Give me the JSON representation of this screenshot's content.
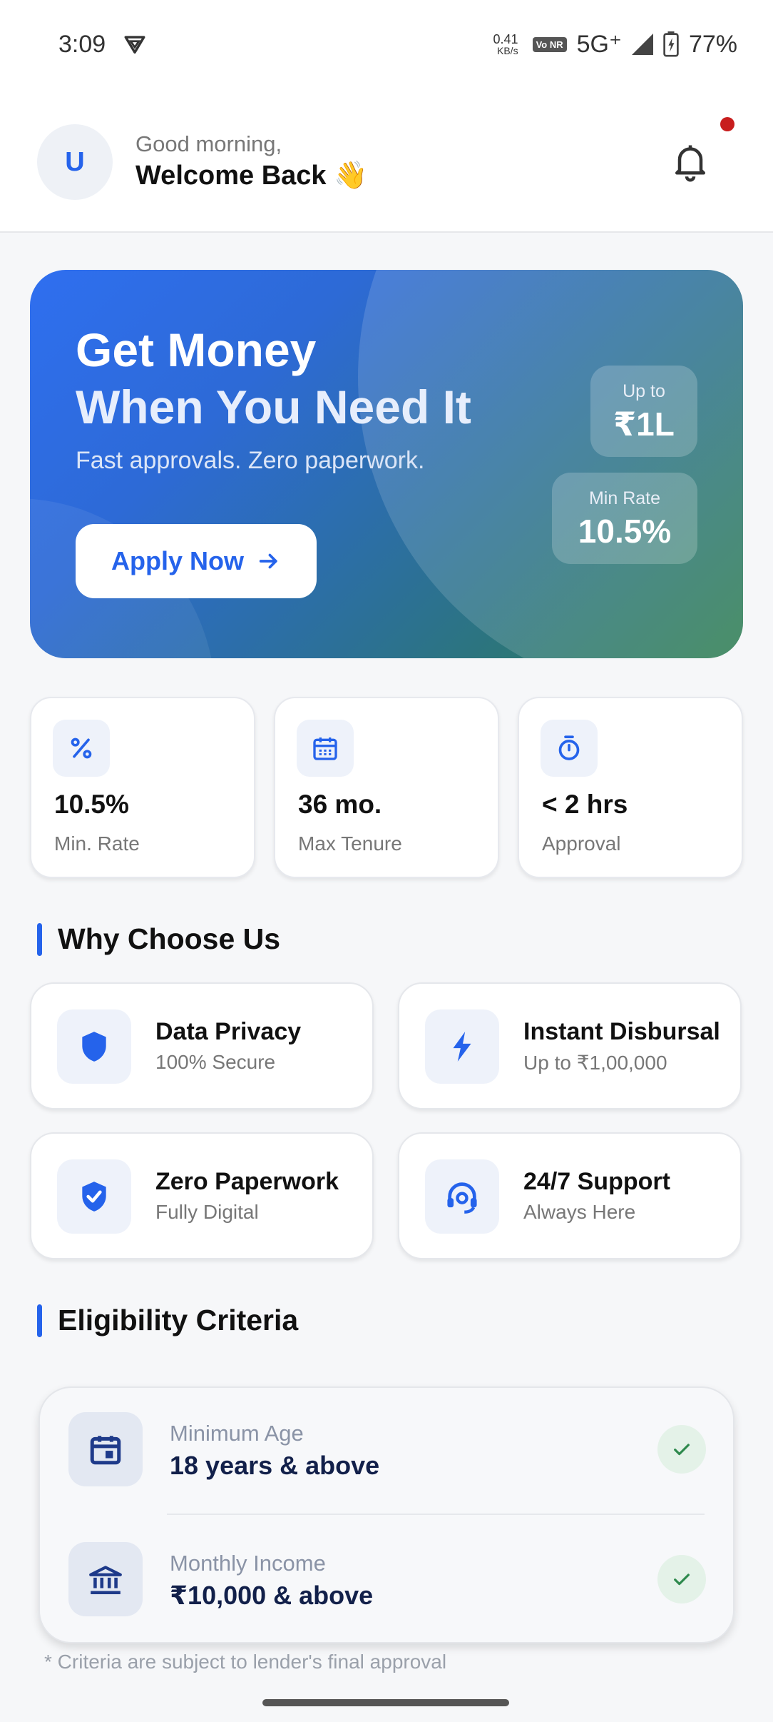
{
  "status_bar": {
    "time": "3:09",
    "net_speed": "0.41",
    "net_unit": "KB/s",
    "volte_label": "Vo NR",
    "network": "5G⁺",
    "battery": "77%"
  },
  "header": {
    "avatar_initial": "U",
    "greeting": "Good morning,",
    "welcome": "Welcome Back 👋",
    "notification_dot_color": "#c81e1e"
  },
  "hero": {
    "title_line1": "Get Money",
    "title_line2": "When You Need It",
    "subtitle": "Fast approvals. Zero paperwork.",
    "apply_label": "Apply Now",
    "upto_label": "Up to",
    "upto_value": "₹1L",
    "minrate_label": "Min Rate",
    "minrate_value": "10.5%"
  },
  "stats": [
    {
      "icon": "percent-icon",
      "value": "10.5%",
      "label": "Min. Rate"
    },
    {
      "icon": "calendar-icon",
      "value": "36 mo.",
      "label": "Max Tenure"
    },
    {
      "icon": "timer-icon",
      "value": "< 2 hrs",
      "label": "Approval"
    }
  ],
  "why": {
    "title": "Why Choose Us",
    "features": [
      {
        "icon": "shield-icon",
        "title": "Data Privacy",
        "subtitle": "100% Secure"
      },
      {
        "icon": "lightning-icon",
        "title": "Instant Disbursal",
        "subtitle": "Up to ₹1,00,000"
      },
      {
        "icon": "shield-check-icon",
        "title": "Zero Paperwork",
        "subtitle": "Fully Digital"
      },
      {
        "icon": "headset-icon",
        "title": "24/7 Support",
        "subtitle": "Always Here"
      }
    ]
  },
  "eligibility": {
    "title": "Eligibility Criteria",
    "items": [
      {
        "icon": "calendar-icon",
        "label": "Minimum Age",
        "value": "18 years & above"
      },
      {
        "icon": "bank-icon",
        "label": "Monthly Income",
        "value": "₹10,000 & above"
      }
    ],
    "note": "* Criteria are subject to lender's final approval"
  },
  "colors": {
    "accent": "#2563eb",
    "check_green": "#2f8a4e"
  }
}
